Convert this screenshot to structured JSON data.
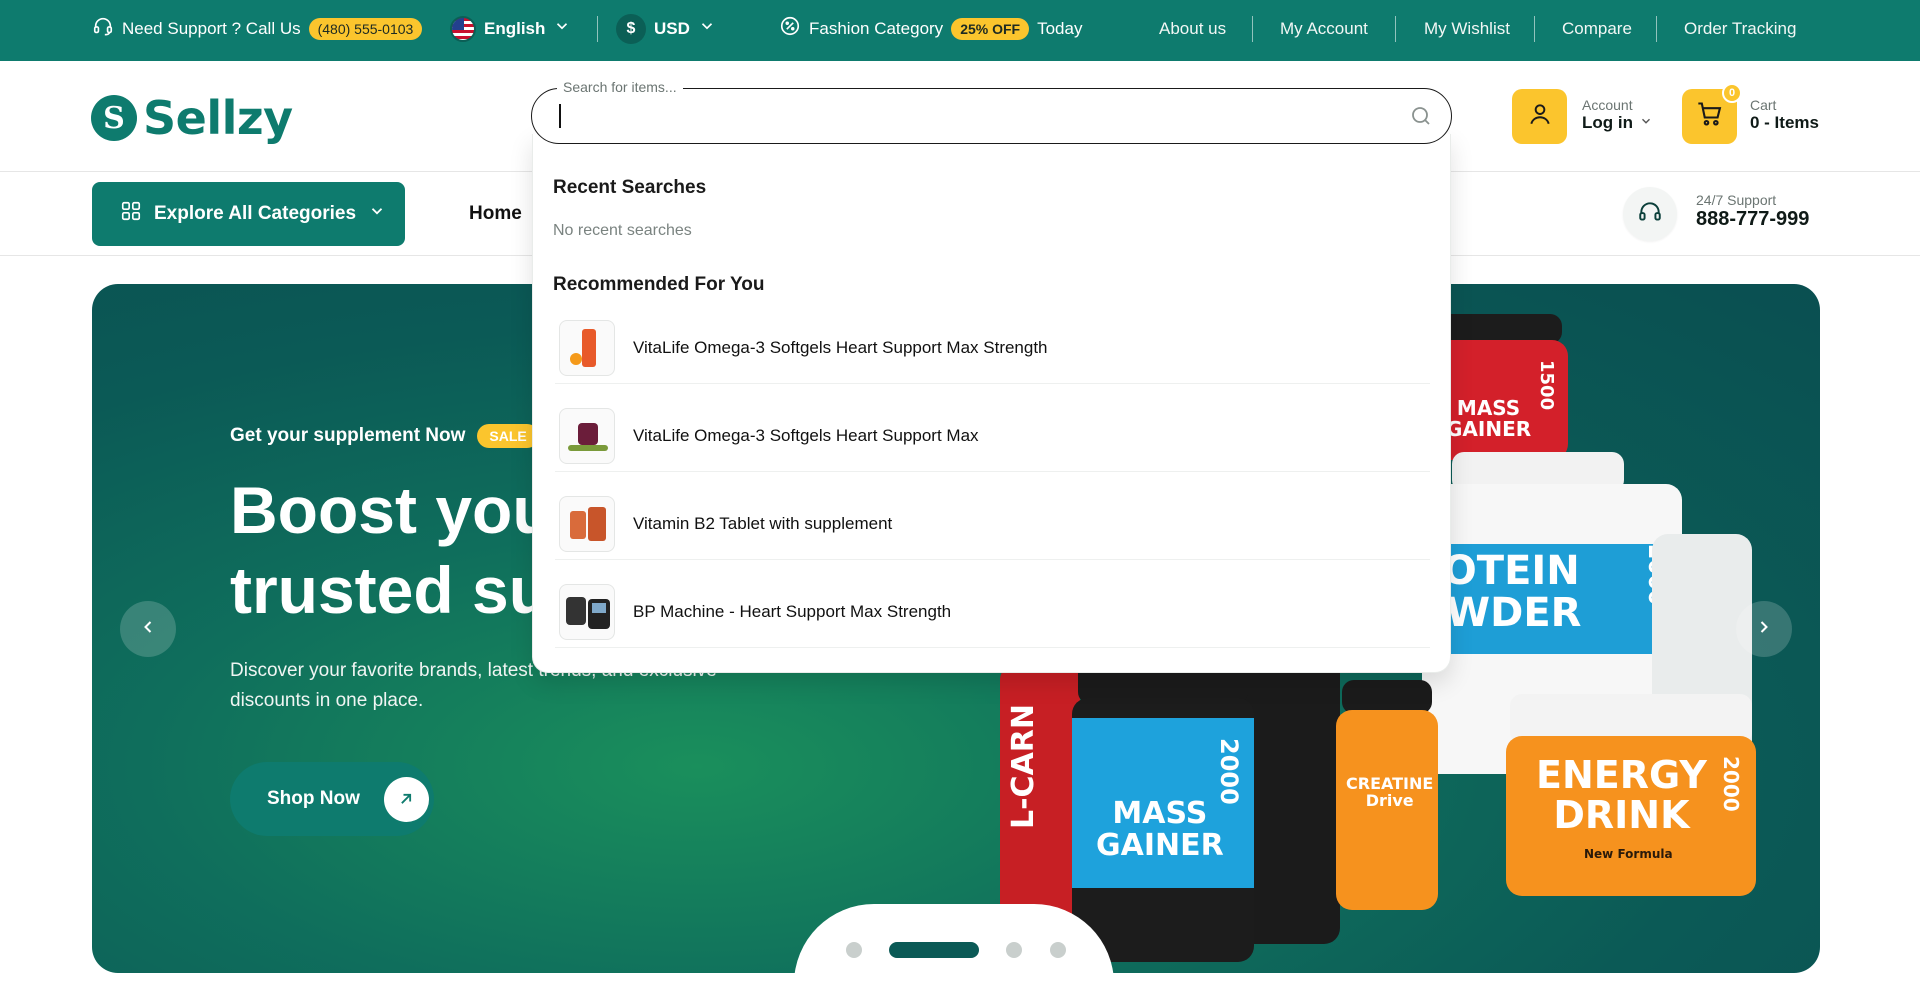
{
  "topbar": {
    "support_text": "Need Support ?  Call Us",
    "phone": "(480) 555-0103",
    "language": "English",
    "currency": "USD",
    "currency_symbol": "$",
    "promo_text": "Fashion Category",
    "promo_badge": "25% OFF",
    "promo_suffix": "Today",
    "links": [
      "About us",
      "My Account",
      "My Wishlist",
      "Compare",
      "Order Tracking"
    ]
  },
  "header": {
    "logo_mark": "S",
    "logo_text": "Sellzy",
    "search_placeholder": "Search for items...",
    "account_small": "Account",
    "account_strong": "Log in",
    "cart_small": "Cart",
    "cart_strong": "0 - Items",
    "cart_count": "0"
  },
  "nav": {
    "explore_label": "Explore All Categories",
    "home_label": "Home",
    "support_small": "24/7 Support",
    "support_phone": "888-777-999"
  },
  "search_dropdown": {
    "recent_heading": "Recent Searches",
    "recent_empty": "No recent searches",
    "recommended_heading": "Recommended For You",
    "items": [
      {
        "name": "VitaLife Omega-3 Softgels Heart Support Max Strength",
        "thumb_icon": "supplement-bottle-icon"
      },
      {
        "name": "VitaLife Omega-3 Softgels Heart Support Max",
        "thumb_icon": "supplement-jar-icon"
      },
      {
        "name": "Vitamin B2 Tablet with supplement",
        "thumb_icon": "tablet-bottle-icon"
      },
      {
        "name": "BP Machine - Heart Support Max Strength",
        "thumb_icon": "bp-machine-icon"
      }
    ]
  },
  "hero": {
    "eyebrow": "Get your supplement Now",
    "sale_badge": "SALE",
    "title_line1": "Boost your",
    "title_line2": "trusted su",
    "description": "Discover your favorite brands, latest trends, and exclusive discounts in one place.",
    "cta": "Shop Now",
    "slides_total": 4,
    "active_slide": 2,
    "product_labels": {
      "mass1500": "MASS\nGAINER",
      "mass1500_num": "1500",
      "protein": "ROTEIN\nOWDER",
      "protein_num": "2000",
      "mass2000": "MASS\nGAINER",
      "mass2000_num": "2000",
      "creatine": "CREATINE\nDrive",
      "energy": "ENERGY\nDRINK",
      "energy_num": "2000",
      "energy_sub": "New Formula",
      "lcarn": "L-CARN"
    }
  },
  "colors": {
    "brand_green": "#0e7b6e",
    "accent_yellow": "#fbc52d",
    "hero_dark": "#0b5a56"
  }
}
